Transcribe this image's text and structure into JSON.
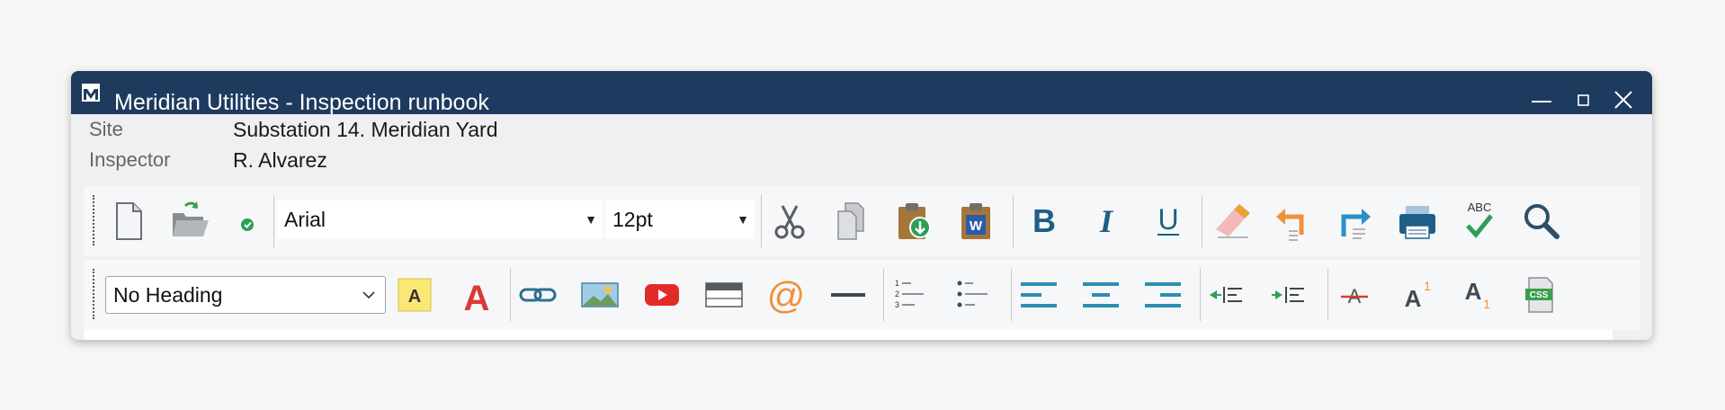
{
  "window": {
    "title": "Meridian Utilities - Inspection runbook",
    "titlebar_color": "#1f3a5f"
  },
  "meta": {
    "site_label": "Site",
    "site_value": "Substation 14. Meridian Yard",
    "inspector_label": "Inspector",
    "inspector_value": "R. Alvarez"
  },
  "toolbar1": {
    "font_family": "Arial",
    "font_size": "12pt",
    "icons": [
      "new-document-icon",
      "open-folder-icon",
      "check-icon",
      "cut-icon",
      "copy-icon",
      "paste-icon",
      "paste-from-word-icon",
      "bold-icon",
      "italic-icon",
      "underline-icon",
      "eraser-icon",
      "undo-icon",
      "redo-icon",
      "print-icon",
      "spellcheck-icon",
      "search-icon"
    ]
  },
  "toolbar2": {
    "heading": "No Heading",
    "icons": [
      "highlight-color-icon",
      "text-color-icon",
      "link-icon",
      "image-icon",
      "youtube-icon",
      "table-icon",
      "email-icon",
      "horizontal-rule-icon",
      "numbered-list-icon",
      "bulleted-list-icon",
      "align-left-icon",
      "align-center-icon",
      "align-right-icon",
      "outdent-icon",
      "indent-icon",
      "strikethrough-icon",
      "superscript-icon",
      "subscript-icon",
      "css-icon"
    ],
    "spellcheck_label": "ABC",
    "css_label": "CSS",
    "highlight_letter": "A",
    "text_color_letter": "A",
    "superscript_letter": "A",
    "superscript_digit": "1",
    "subscript_letter": "A",
    "subscript_digit": "1",
    "bold_letter": "B",
    "italic_letter": "I",
    "underline_letter": "U",
    "word_letter": "W"
  }
}
